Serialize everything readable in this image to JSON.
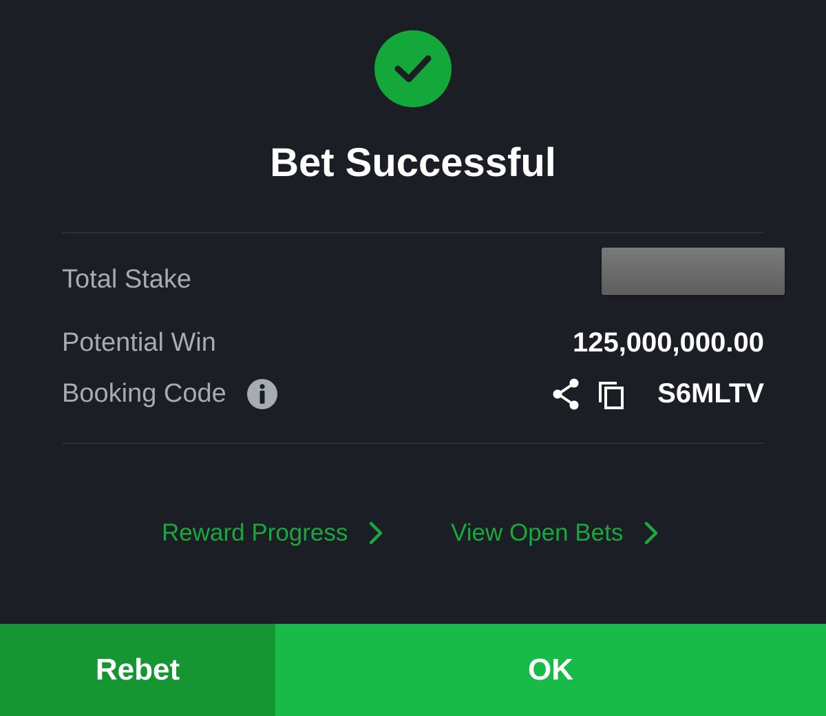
{
  "header": {
    "title": "Bet Successful",
    "status_icon": "checkmark-circle-icon"
  },
  "summary": {
    "total_stake_label": "Total Stake",
    "total_stake_value": "",
    "potential_win_label": "Potential Win",
    "potential_win_value": "125,000,000.00",
    "booking_code_label": "Booking Code",
    "booking_code_value": "S6MLTV",
    "icons": [
      "info-icon",
      "share-icon",
      "copy-icon"
    ]
  },
  "links": {
    "reward_progress": "Reward Progress",
    "view_open_bets": "View Open Bets"
  },
  "footer": {
    "rebet_label": "Rebet",
    "ok_label": "OK"
  },
  "colors": {
    "background": "#1b1e24",
    "accent_green": "#18bb47",
    "rebet_green": "#159632",
    "link_green": "#18a83b"
  }
}
